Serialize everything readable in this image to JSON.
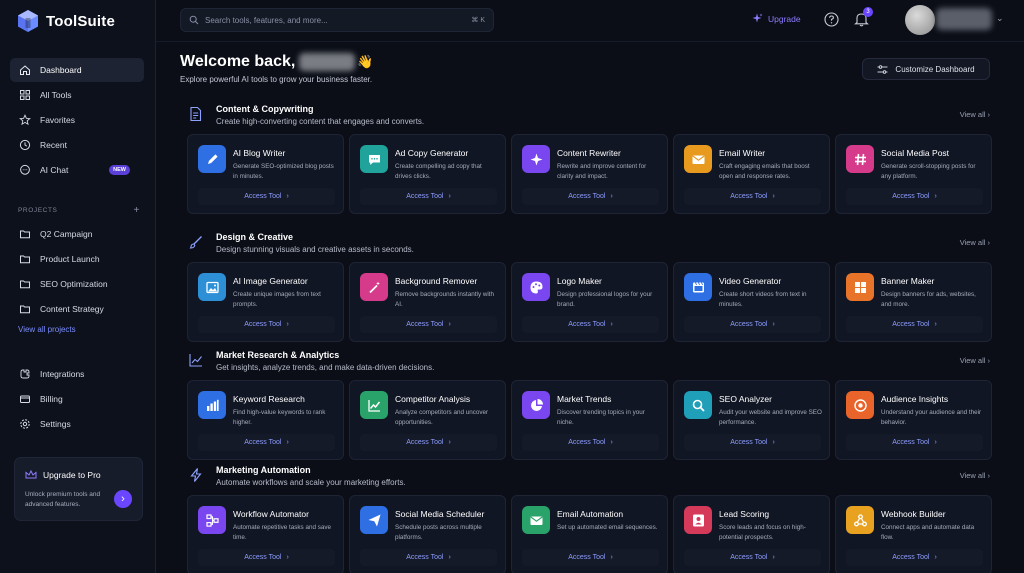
{
  "app": {
    "name": "ToolSuite"
  },
  "sidebar": {
    "nav": [
      {
        "label": "Dashboard",
        "icon": "home-icon",
        "active": true
      },
      {
        "label": "All Tools",
        "icon": "grid-icon"
      },
      {
        "label": "Favorites",
        "icon": "star-icon"
      },
      {
        "label": "Recent",
        "icon": "clock-icon"
      },
      {
        "label": "AI Chat",
        "icon": "chat-icon",
        "badge": "NEW"
      }
    ],
    "projects_label": "PROJECTS",
    "projects": [
      "Q2 Campaign",
      "Product Launch",
      "SEO Optimization",
      "Content Strategy"
    ],
    "view_all_projects": "View all projects",
    "bottom_nav": [
      {
        "label": "Integrations",
        "icon": "integrations-icon"
      },
      {
        "label": "Billing",
        "icon": "billing-icon"
      },
      {
        "label": "Settings",
        "icon": "gear-icon"
      }
    ],
    "upgrade_card": {
      "title": "Upgrade to Pro",
      "desc": "Unlock premium tools and advanced features."
    }
  },
  "topbar": {
    "search_placeholder": "Search tools, features, and more...",
    "shortcut": "⌘ K",
    "upgrade_label": "Upgrade",
    "notifications_count": "3"
  },
  "main": {
    "welcome": "Welcome back,",
    "subtitle": "Explore powerful AI tools to grow your business faster.",
    "customize_label": "Customize Dashboard",
    "access_label": "Access Tool",
    "view_all_label": "View all",
    "sections": [
      {
        "title": "Content & Copywriting",
        "desc": "Create high-converting content that engages and converts.",
        "tools": [
          {
            "name": "AI Blog Writer",
            "desc": "Generate SEO-optimized blog posts in minutes.",
            "color": "#2f6fe4",
            "icon": "pen-icon"
          },
          {
            "name": "Ad Copy Generator",
            "desc": "Create compelling ad copy that drives clicks.",
            "color": "#1fa39a",
            "icon": "chat-bubble-icon"
          },
          {
            "name": "Content Rewriter",
            "desc": "Rewrite and improve content for clarity and impact.",
            "color": "#7a46f0",
            "icon": "sparkle-icon"
          },
          {
            "name": "Email Writer",
            "desc": "Craft engaging emails that boost open and response rates.",
            "color": "#e89a1f",
            "icon": "mail-icon"
          },
          {
            "name": "Social Media Post",
            "desc": "Generate scroll-stopping posts for any platform.",
            "color": "#d63a8a",
            "icon": "hash-icon"
          }
        ]
      },
      {
        "title": "Design & Creative",
        "desc": "Design stunning visuals and creative assets in seconds.",
        "tools": [
          {
            "name": "AI Image Generator",
            "desc": "Create unique images from text prompts.",
            "color": "#2d8fd6",
            "icon": "image-icon"
          },
          {
            "name": "Background Remover",
            "desc": "Remove backgrounds instantly with AI.",
            "color": "#d63a8a",
            "icon": "magic-wand-icon"
          },
          {
            "name": "Logo Maker",
            "desc": "Design professional logos for your brand.",
            "color": "#7a46f0",
            "icon": "palette-icon"
          },
          {
            "name": "Video Generator",
            "desc": "Create short videos from text in minutes.",
            "color": "#2f6fe4",
            "icon": "video-icon"
          },
          {
            "name": "Banner Maker",
            "desc": "Design banners for ads, websites, and more.",
            "color": "#e8742a",
            "icon": "layout-icon"
          }
        ]
      },
      {
        "title": "Market Research & Analytics",
        "desc": "Get insights, analyze trends, and make data-driven decisions.",
        "tools": [
          {
            "name": "Keyword Research",
            "desc": "Find high-value keywords to rank higher.",
            "color": "#2f6fe4",
            "icon": "bar-chart-icon"
          },
          {
            "name": "Competitor Analysis",
            "desc": "Analyze competitors and uncover opportunities.",
            "color": "#2aa36a",
            "icon": "line-chart-icon"
          },
          {
            "name": "Market Trends",
            "desc": "Discover trending topics in your niche.",
            "color": "#7a46f0",
            "icon": "pie-chart-icon"
          },
          {
            "name": "SEO Analyzer",
            "desc": "Audit your website and improve SEO performance.",
            "color": "#1f9fb8",
            "icon": "magnifier-icon"
          },
          {
            "name": "Audience Insights",
            "desc": "Understand your audience and their behavior.",
            "color": "#e8642a",
            "icon": "target-icon"
          }
        ]
      },
      {
        "title": "Marketing Automation",
        "desc": "Automate workflows and scale your marketing efforts.",
        "tools": [
          {
            "name": "Workflow Automator",
            "desc": "Automate repetitive tasks and save time.",
            "color": "#7a46f0",
            "icon": "workflow-icon"
          },
          {
            "name": "Social Media Scheduler",
            "desc": "Schedule posts across multiple platforms.",
            "color": "#2f6fe4",
            "icon": "send-icon"
          },
          {
            "name": "Email Automation",
            "desc": "Set up automated email sequences.",
            "color": "#2aa36a",
            "icon": "mail-icon"
          },
          {
            "name": "Lead Scoring",
            "desc": "Score leads and focus on high-potential prospects.",
            "color": "#d63a5a",
            "icon": "user-icon"
          },
          {
            "name": "Webhook Builder",
            "desc": "Connect apps and automate data flow.",
            "color": "#e8a21f",
            "icon": "webhook-icon"
          }
        ]
      }
    ]
  }
}
